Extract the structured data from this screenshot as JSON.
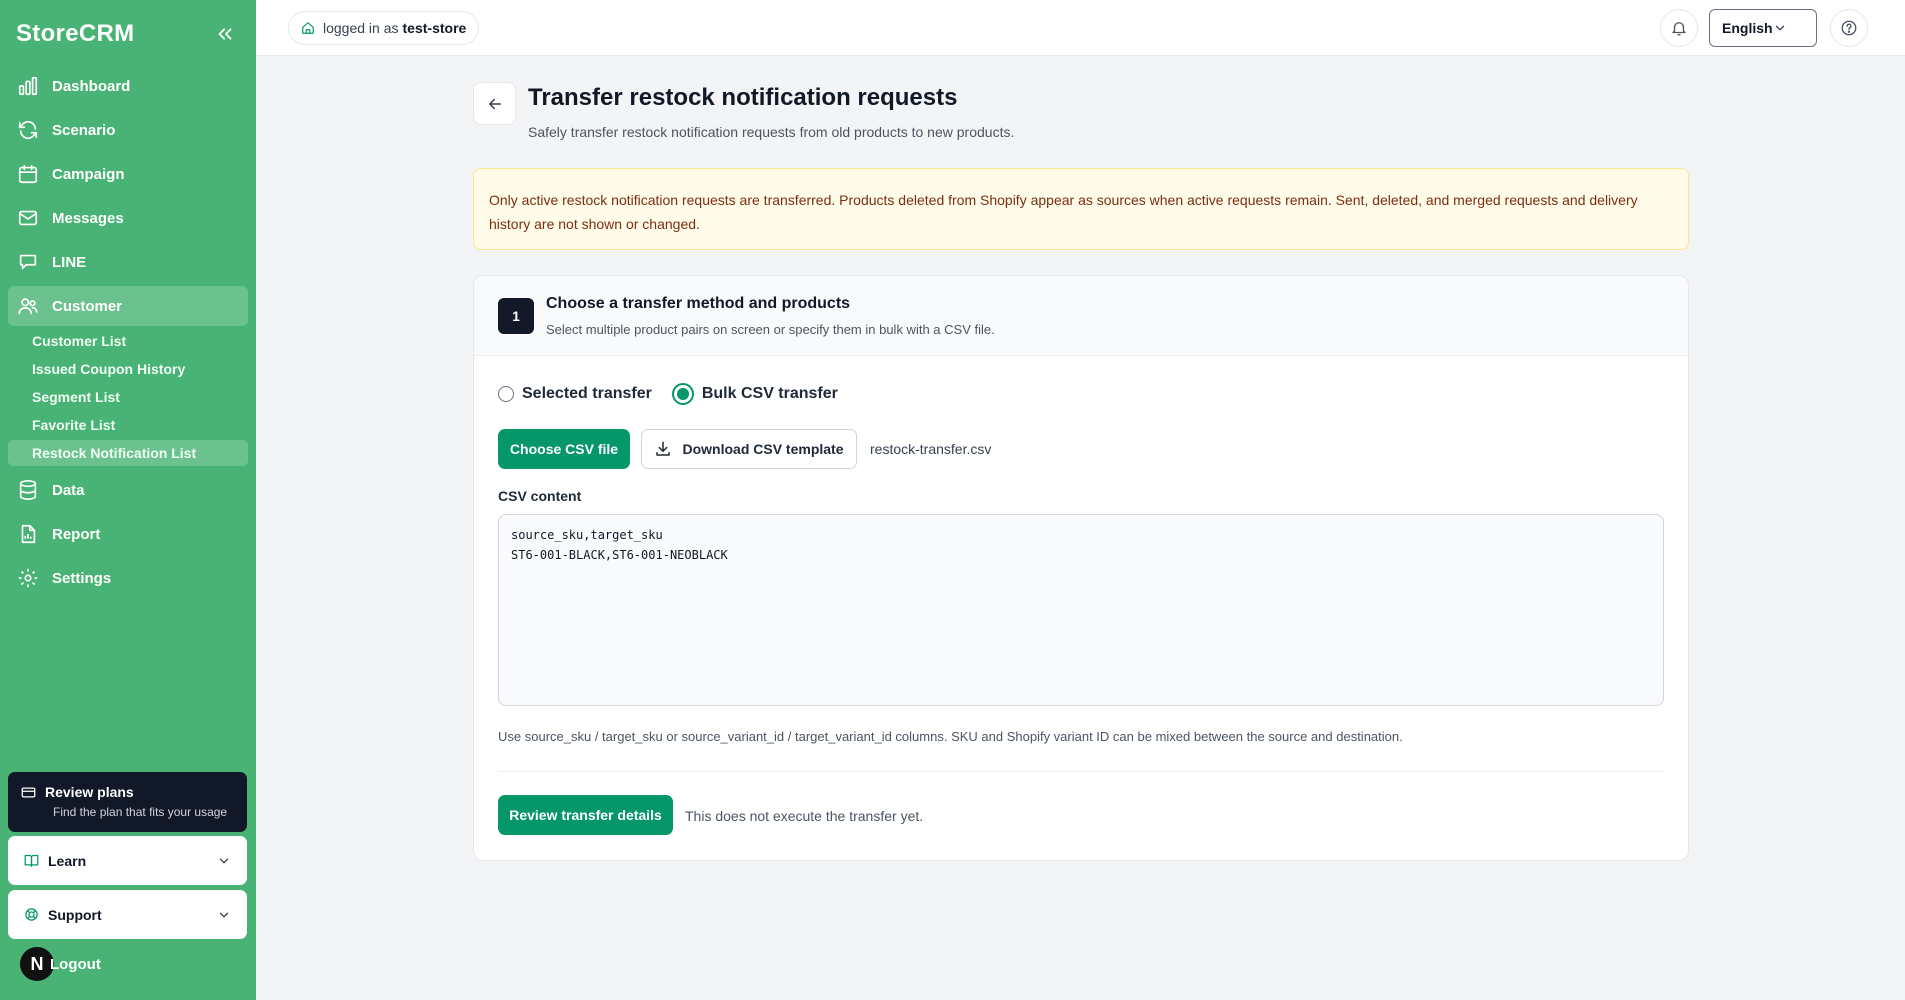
{
  "app": {
    "name": "StoreCRM"
  },
  "sidebar": {
    "items": [
      {
        "label": "Dashboard",
        "icon": "bar-chart-icon"
      },
      {
        "label": "Scenario",
        "icon": "refresh-icon"
      },
      {
        "label": "Campaign",
        "icon": "calendar-icon"
      },
      {
        "label": "Messages",
        "icon": "mail-icon"
      },
      {
        "label": "LINE",
        "icon": "chat-icon"
      },
      {
        "label": "Customer",
        "icon": "users-icon",
        "active": true
      }
    ],
    "customer_sub": [
      {
        "label": "Customer List"
      },
      {
        "label": "Issued Coupon History"
      },
      {
        "label": "Segment List"
      },
      {
        "label": "Favorite List"
      },
      {
        "label": "Restock Notification List",
        "active": true
      }
    ],
    "items_after": [
      {
        "label": "Data",
        "icon": "database-icon"
      },
      {
        "label": "Report",
        "icon": "file-chart-icon"
      },
      {
        "label": "Settings",
        "icon": "gear-icon"
      }
    ],
    "plans": {
      "title": "Review plans",
      "desc": "Find the plan that fits your usage"
    },
    "learn": "Learn",
    "support": "Support",
    "logout": "Logout",
    "avatar_letter": "N"
  },
  "topbar": {
    "logged_in_prefix": "logged in as",
    "store": "test-store",
    "language": "English"
  },
  "page": {
    "title": "Transfer restock notification requests",
    "subtitle": "Safely transfer restock notification requests from old products to new products.",
    "notice": "Only active restock notification requests are transferred. Products deleted from Shopify appear as sources when active requests remain. Sent, deleted, and merged requests and delivery history are not shown or changed."
  },
  "step1": {
    "number": "1",
    "title": "Choose a transfer method and products",
    "subtitle": "Select multiple product pairs on screen or specify them in bulk with a CSV file.",
    "radio_selected": "Selected transfer",
    "radio_bulk": "Bulk CSV transfer",
    "selected_mode": "bulk",
    "choose_csv": "Choose CSV file",
    "download_template": "Download CSV template",
    "file_name": "restock-transfer.csv",
    "csv_label": "CSV content",
    "csv_content": "source_sku,target_sku\nST6-001-BLACK,ST6-001-NEOBLACK",
    "hint": "Use source_sku / target_sku or source_variant_id / target_variant_id columns. SKU and Shopify variant ID can be mixed between the source and destination.",
    "review_button": "Review transfer details",
    "exec_note": "This does not execute the transfer yet."
  },
  "colors": {
    "sidebar": "#48b374",
    "primary": "#059669",
    "notice_bg": "#fefce8",
    "dark": "#111827"
  }
}
